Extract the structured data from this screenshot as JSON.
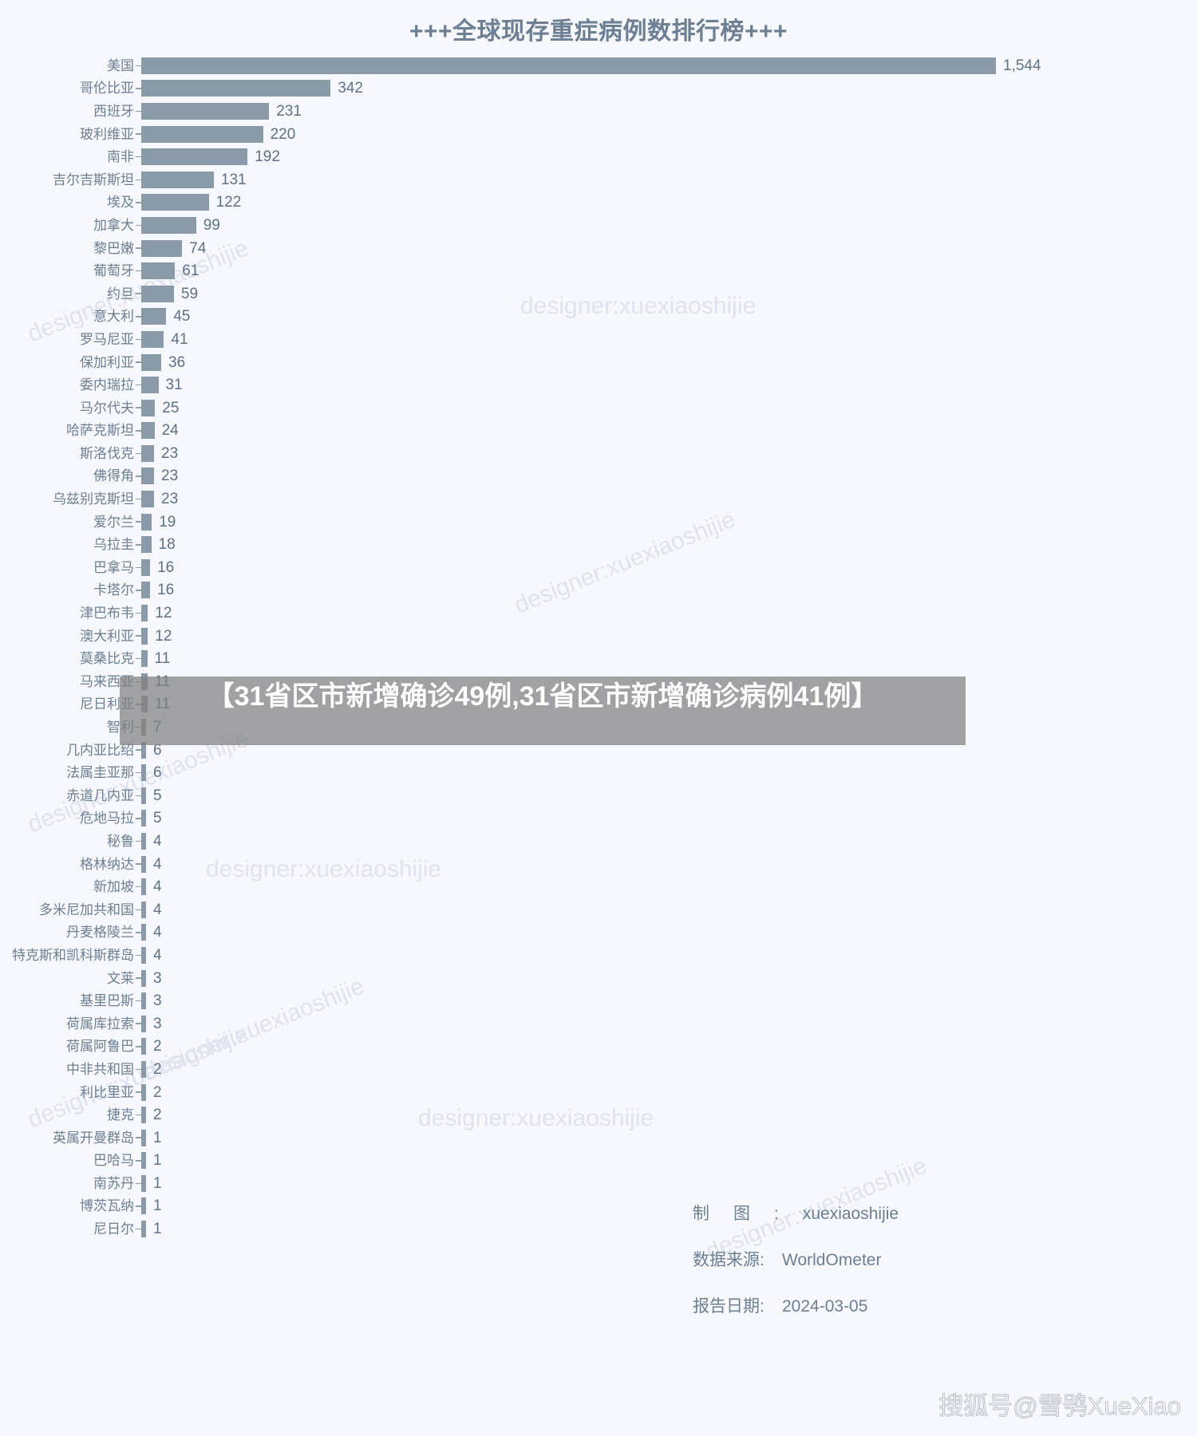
{
  "chart": {
    "title": "+++全球现存重症病例数排行榜+++"
  },
  "overlay": {
    "text": "【31省区市新增确诊49例,31省区市新增确诊病例41例】"
  },
  "meta": {
    "designer_key": "制图:",
    "designer_value": "xuexiaoshijie",
    "source_key": "数据来源:",
    "source_value": "WorldOmeter",
    "date_key": "报告日期:",
    "date_value": "2024-03-05"
  },
  "watermarks": {
    "text": "designer:xuexiaoshijie",
    "site": "搜狐号@雪鸮XueXiao"
  },
  "colors": {
    "background": "#f6f8fd",
    "bar": "#8b9aa9",
    "text": "#6d7f93",
    "watermark": "#dfe3ef",
    "overlay_bg": "rgba(128,128,128,0.72)"
  },
  "chart_data": {
    "type": "bar",
    "orientation": "horizontal",
    "title": "+++全球现存重症病例数排行榜+++",
    "xlabel": "",
    "ylabel": "",
    "grid": false,
    "legend": false,
    "xlim": [
      0,
      1544
    ],
    "value_labels": true,
    "categories": [
      "美国",
      "哥伦比亚",
      "西班牙",
      "玻利维亚",
      "南非",
      "吉尔吉斯斯坦",
      "埃及",
      "加拿大",
      "黎巴嫩",
      "葡萄牙",
      "约旦",
      "意大利",
      "罗马尼亚",
      "保加利亚",
      "委内瑞拉",
      "马尔代夫",
      "哈萨克斯坦",
      "斯洛伐克",
      "佛得角",
      "乌兹别克斯坦",
      "爱尔兰",
      "乌拉圭",
      "巴拿马",
      "卡塔尔",
      "津巴布韦",
      "澳大利亚",
      "莫桑比克",
      "马来西亚",
      "尼日利亚",
      "智利",
      "几内亚比绍",
      "法属圭亚那",
      "赤道几内亚",
      "危地马拉",
      "秘鲁",
      "格林纳达",
      "新加坡",
      "多米尼加共和国",
      "丹麦格陵兰",
      "特克斯和凯科斯群岛",
      "文莱",
      "基里巴斯",
      "荷属库拉索",
      "荷属阿鲁巴",
      "中非共和国",
      "利比里亚",
      "捷克",
      "英属开曼群岛",
      "巴哈马",
      "南苏丹",
      "博茨瓦纳",
      "尼日尔"
    ],
    "values": [
      1544,
      342,
      231,
      220,
      192,
      131,
      122,
      99,
      74,
      61,
      59,
      45,
      41,
      36,
      31,
      25,
      24,
      23,
      23,
      23,
      19,
      18,
      16,
      16,
      12,
      12,
      11,
      11,
      11,
      7,
      6,
      6,
      5,
      5,
      4,
      4,
      4,
      4,
      4,
      4,
      3,
      3,
      3,
      2,
      2,
      2,
      2,
      1,
      1,
      1,
      1,
      1
    ],
    "value_label_texts": [
      "1,544",
      "342",
      "231",
      "220",
      "192",
      "131",
      "122",
      "99",
      "74",
      "61",
      "59",
      "45",
      "41",
      "36",
      "31",
      "25",
      "24",
      "23",
      "23",
      "23",
      "19",
      "18",
      "16",
      "16",
      "12",
      "12",
      "11",
      "11",
      "11",
      "7",
      "6",
      "6",
      "5",
      "5",
      "4",
      "4",
      "4",
      "4",
      "4",
      "4",
      "3",
      "3",
      "3",
      "2",
      "2",
      "2",
      "2",
      "1",
      "1",
      "1",
      "1",
      "1"
    ]
  }
}
